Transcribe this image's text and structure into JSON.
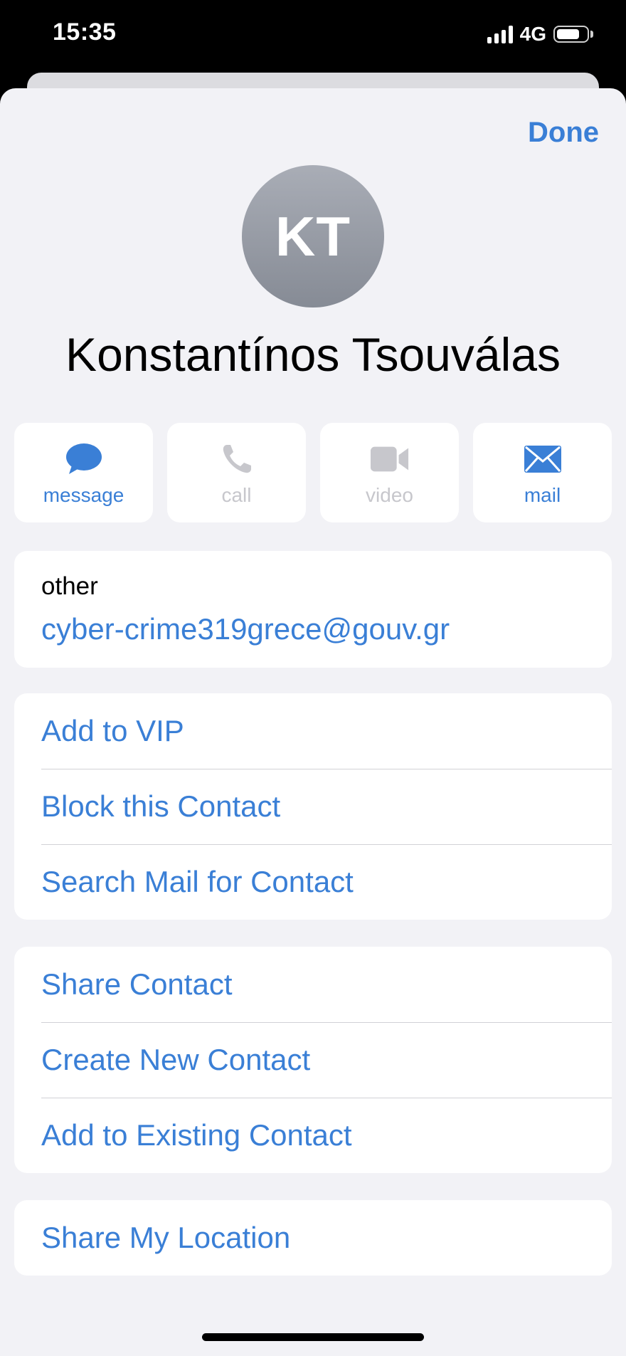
{
  "status_bar": {
    "time": "15:35",
    "network": "4G"
  },
  "header": {
    "done_label": "Done"
  },
  "contact": {
    "initials": "KT",
    "name": "Konstantínos Tsouválas"
  },
  "actions": [
    {
      "label": "message",
      "icon": "message-bubble-icon",
      "enabled": true
    },
    {
      "label": "call",
      "icon": "phone-icon",
      "enabled": false
    },
    {
      "label": "video",
      "icon": "video-camera-icon",
      "enabled": false
    },
    {
      "label": "mail",
      "icon": "envelope-icon",
      "enabled": true
    }
  ],
  "email": {
    "label": "other",
    "value": "cyber-crime319grece@gouv.gr"
  },
  "mail_options": [
    {
      "label": "Add to VIP"
    },
    {
      "label": "Block this Contact"
    },
    {
      "label": "Search Mail for Contact"
    }
  ],
  "contact_options": [
    {
      "label": "Share Contact"
    },
    {
      "label": "Create New Contact"
    },
    {
      "label": "Add to Existing Contact"
    }
  ],
  "location_options": [
    {
      "label": "Share My Location"
    }
  ],
  "colors": {
    "accent": "#3a7fd6",
    "disabled": "#c7c7cc",
    "sheet_background": "#f2f2f6",
    "avatar": "#989ca6"
  }
}
